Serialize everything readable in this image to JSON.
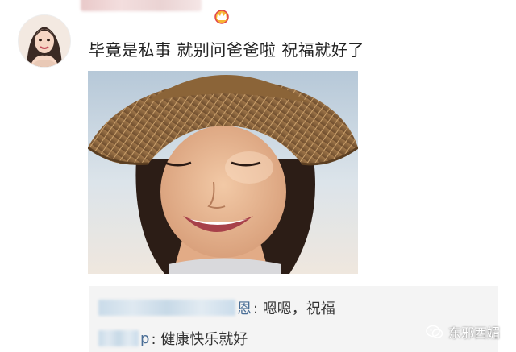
{
  "post": {
    "comment_text": "毕竟是私事 就别问爸爸啦 祝福就好了"
  },
  "replies": [
    {
      "suffix": "恩",
      "text": ": 嗯嗯，祝福"
    },
    {
      "suffix": "p",
      "text": ": 健康快乐就好"
    }
  ],
  "watermark": {
    "text": "东邪西媚"
  },
  "colors": {
    "text": "#222222",
    "reply_bg": "#f4f4f4",
    "reply_name": "#4a6e96"
  }
}
